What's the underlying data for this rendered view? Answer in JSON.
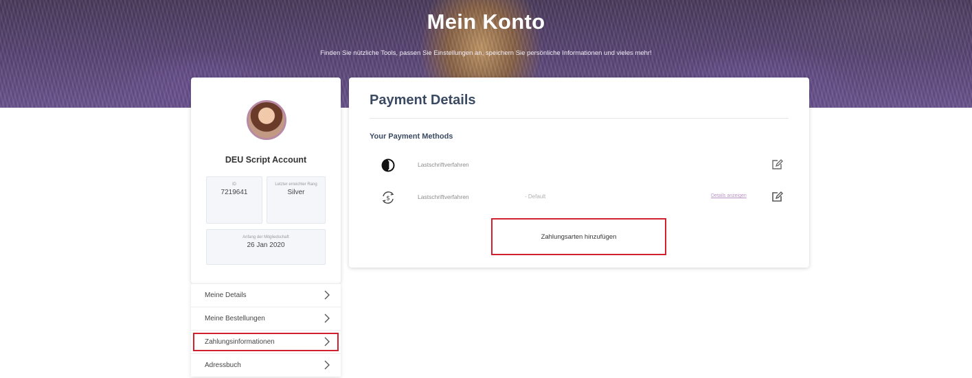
{
  "hero": {
    "title": "Mein Konto",
    "subtitle": "Finden Sie nützliche Tools, passen Sie Einstellungen an, speichern Sie persönliche Informationen und vieles mehr!"
  },
  "profile": {
    "account_name": "DEU Script Account",
    "id_label": "ID",
    "id_value": "7219641",
    "rank_label": "Letzter erreichter Rang",
    "rank_value": "Silver",
    "member_since_label": "Anfang der Mitgliedschaft",
    "member_since_value": "26 Jan 2020"
  },
  "nav": {
    "items": [
      {
        "label": "Meine Details"
      },
      {
        "label": "Meine Bestellungen"
      },
      {
        "label": "Zahlungsinformationen"
      },
      {
        "label": "Adressbuch"
      }
    ]
  },
  "payment": {
    "title": "Payment Details",
    "subtitle": "Your Payment Methods",
    "methods": [
      {
        "name": "Lastschriftverfahren",
        "icon": "direct-debit-icon"
      },
      {
        "name": "Lastschriftverfahren",
        "icon": "currency-exchange-icon",
        "default_label": "- Default",
        "details_link": "Details anzeigen"
      }
    ],
    "add_button": "Zahlungsarten hinzufügen"
  },
  "colors": {
    "title_text": "#3b4a63",
    "highlight": "#d0202e",
    "link": "#b994c4"
  }
}
